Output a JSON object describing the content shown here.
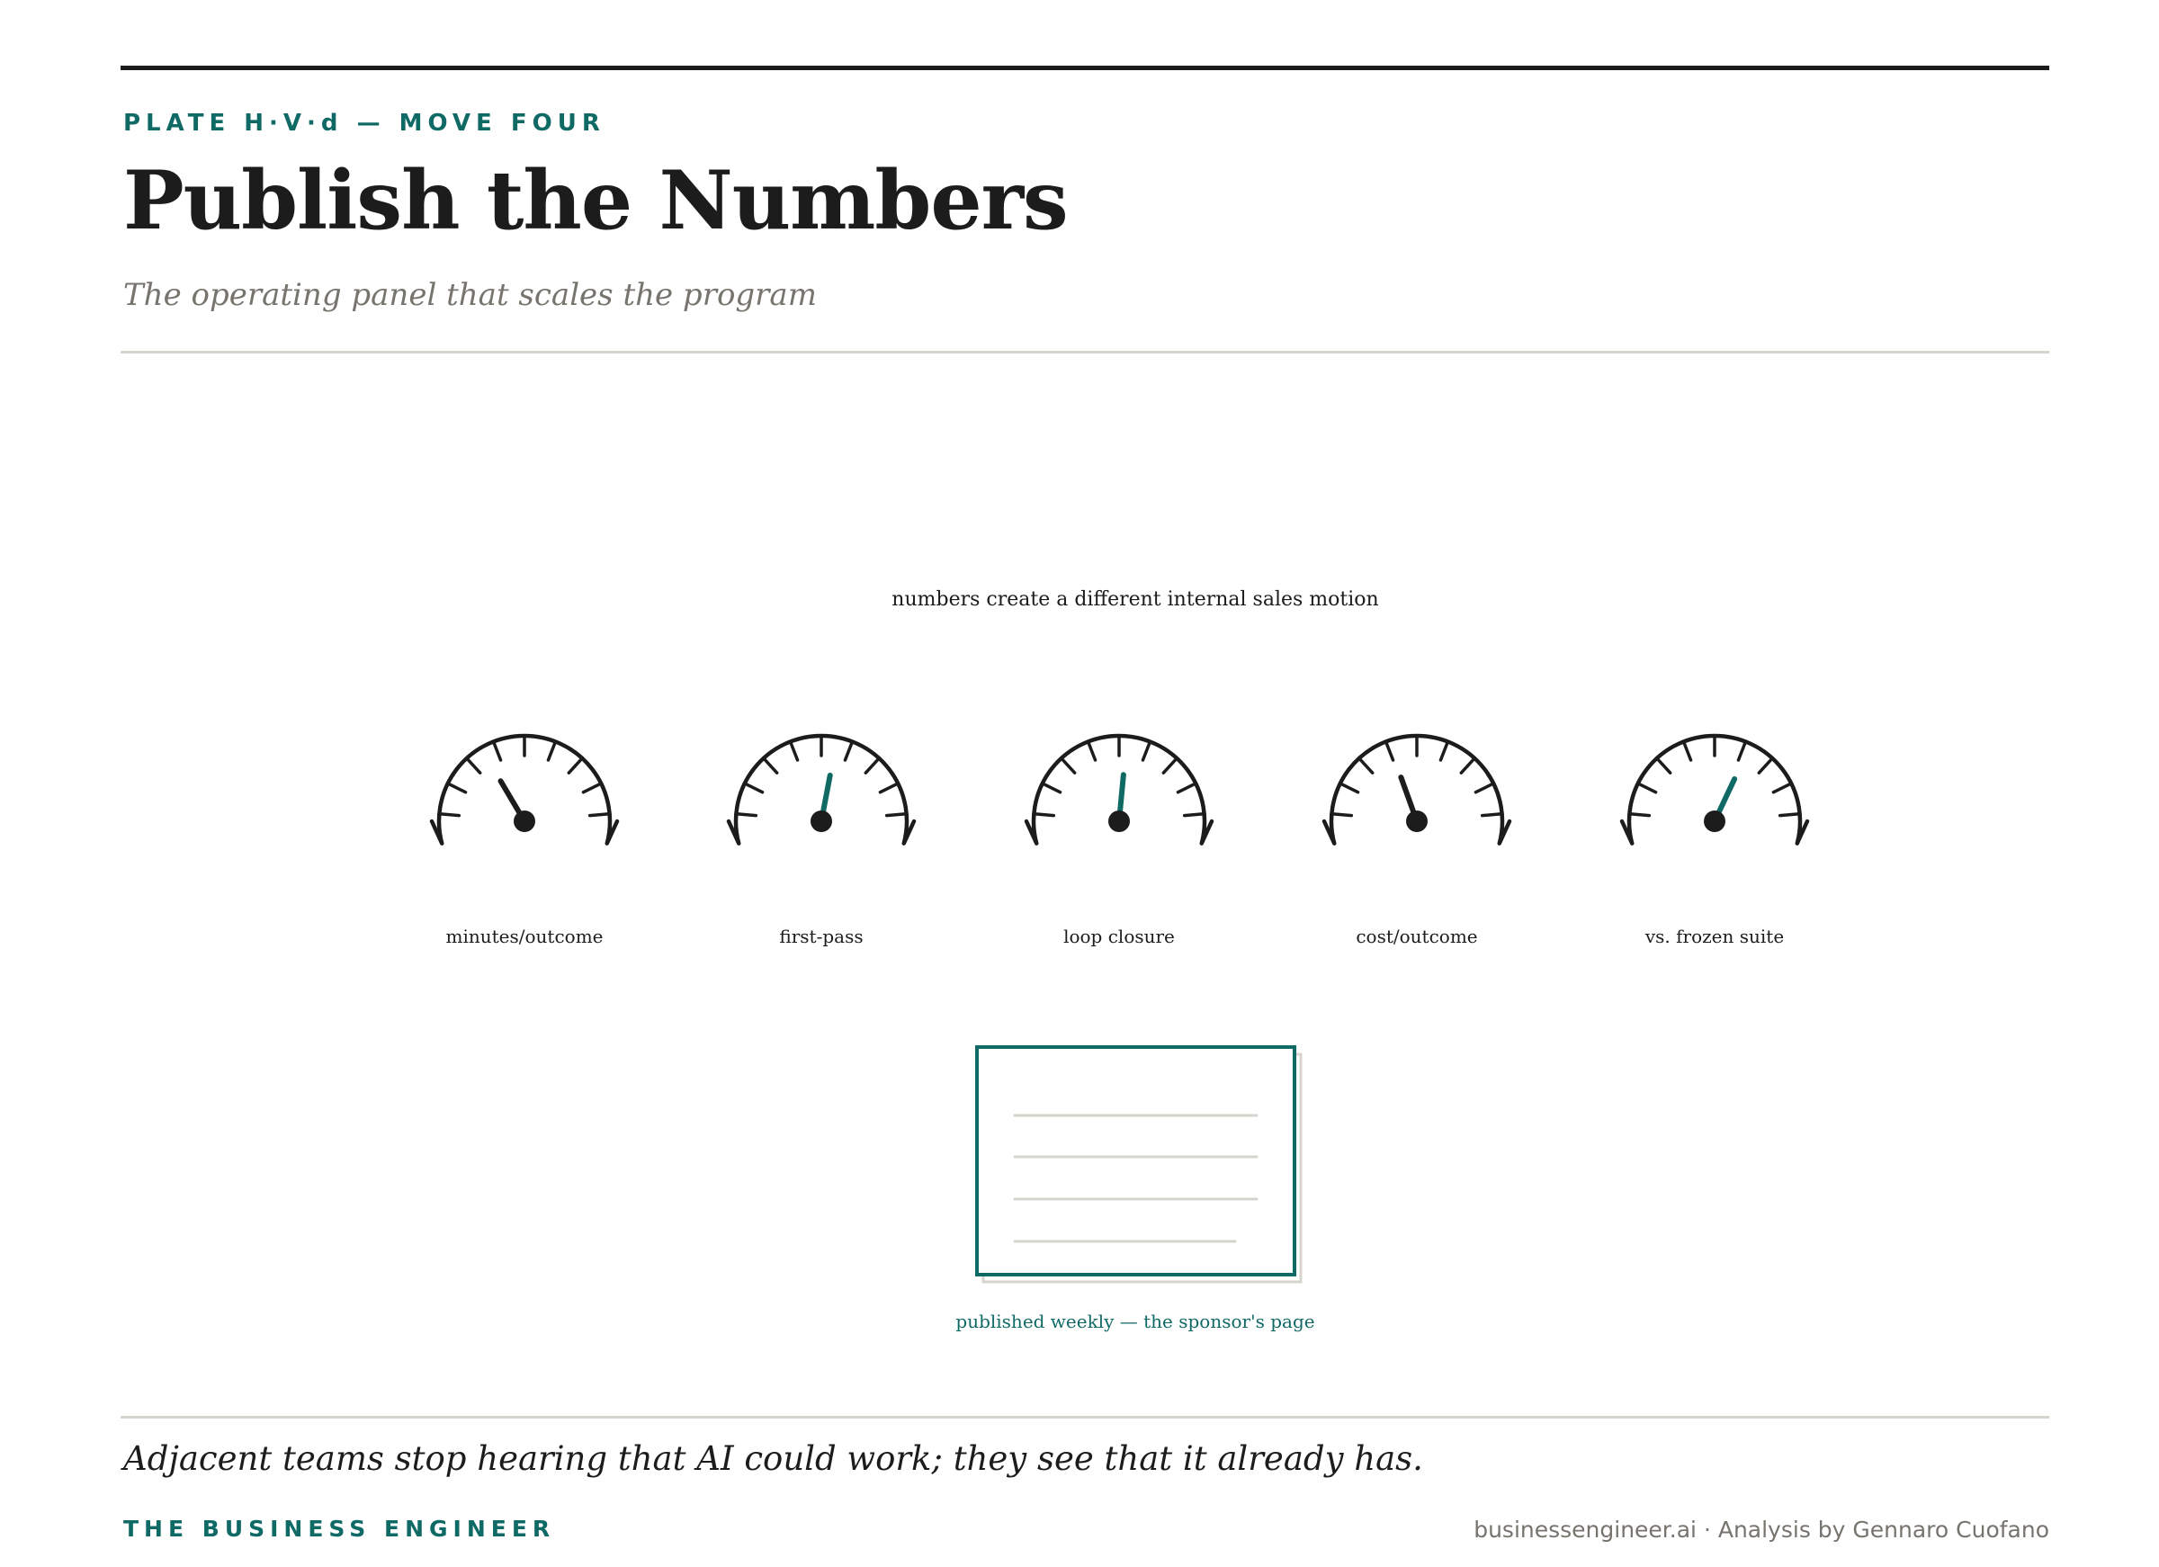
{
  "header": {
    "eyebrow": "PLATE H·V·d — MOVE FOUR",
    "title": "Publish the Numbers",
    "subtitle": "The operating panel that scales the program"
  },
  "diagram": {
    "heading": "numbers create a different internal sales motion",
    "gauges": [
      {
        "label": "minutes/outcome",
        "reading": 0.33,
        "needle_color": "#1c1c1c"
      },
      {
        "label": "first-pass",
        "reading": 0.56,
        "needle_color": "#0f6a66"
      },
      {
        "label": "loop closure",
        "reading": 0.53,
        "needle_color": "#0f6a66"
      },
      {
        "label": "cost/outcome",
        "reading": 0.39,
        "needle_color": "#1c1c1c"
      },
      {
        "label": "vs. frozen suite",
        "reading": 0.64,
        "needle_color": "#0f6a66"
      }
    ],
    "report_caption": "published weekly — the sponsor's page"
  },
  "footer": {
    "caption": "Adjacent teams stop hearing that AI could work; they see that it already has.",
    "brand": "THE BUSINESS ENGINEER",
    "credit": "businessengineer.ai · Analysis by Gennaro Cuofano"
  },
  "colors": {
    "accent": "#0f6a66",
    "ink": "#1c1c1c",
    "muted": "#77746d",
    "rule": "#d6d4cc"
  }
}
